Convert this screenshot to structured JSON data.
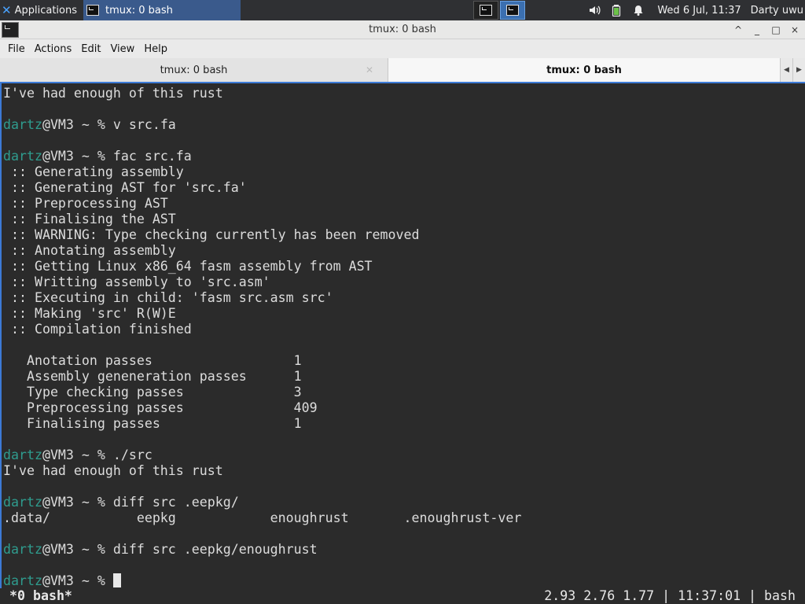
{
  "panel": {
    "apps_label": "Applications",
    "task_label": "tmux: 0 bash",
    "clock": "Wed  6 Jul, 11:37",
    "user": "Darty uwu",
    "icons": [
      "volume-icon",
      "battery-icon",
      "notification-bell-icon"
    ]
  },
  "window": {
    "title": "tmux: 0 bash",
    "controls": [
      "^",
      "_",
      "□",
      "×"
    ]
  },
  "menu": [
    "File",
    "Actions",
    "Edit",
    "View",
    "Help"
  ],
  "tabs": [
    {
      "label": "tmux: 0 bash",
      "active": false
    },
    {
      "label": "tmux: 0 bash",
      "active": true
    }
  ],
  "terminal": {
    "prompt_user": "dartz",
    "prompt_host": "@VM3 ~ % ",
    "lines": [
      {
        "text": "I've had enough of this rust"
      },
      {
        "text": ""
      },
      {
        "prompt": true,
        "cmd": "v src.fa"
      },
      {
        "text": ""
      },
      {
        "prompt": true,
        "cmd": "fac src.fa"
      },
      {
        "text": " :: Generating assembly"
      },
      {
        "text": " :: Generating AST for 'src.fa'"
      },
      {
        "text": " :: Preprocessing AST"
      },
      {
        "text": " :: Finalising the AST"
      },
      {
        "text": " :: WARNING: Type checking currently has been removed"
      },
      {
        "text": " :: Anotating assembly"
      },
      {
        "text": " :: Getting Linux x86_64 fasm assembly from AST"
      },
      {
        "text": " :: Writting assembly to 'src.asm'"
      },
      {
        "text": " :: Executing in child: 'fasm src.asm src'"
      },
      {
        "text": " :: Making 'src' R(W)E"
      },
      {
        "text": " :: Compilation finished"
      },
      {
        "text": ""
      },
      {
        "text": "   Anotation passes                  1"
      },
      {
        "text": "   Assembly geneneration passes      1"
      },
      {
        "text": "   Type checking passes              3"
      },
      {
        "text": "   Preprocessing passes              409"
      },
      {
        "text": "   Finalising passes                 1"
      },
      {
        "text": ""
      },
      {
        "prompt": true,
        "cmd": "./src"
      },
      {
        "text": "I've had enough of this rust"
      },
      {
        "text": ""
      },
      {
        "prompt": true,
        "cmd": "diff src .eepkg/"
      },
      {
        "text": ".data/           eepkg            enoughrust       .enoughrust-ver"
      },
      {
        "text": ""
      },
      {
        "prompt": true,
        "cmd": "diff src .eepkg/enoughrust"
      },
      {
        "text": ""
      },
      {
        "prompt": true,
        "cmd": "",
        "cursor": true
      }
    ]
  },
  "status": {
    "left": "*0 bash*",
    "right": "2.93 2.76 1.77 | 11:37:01 | bash"
  }
}
